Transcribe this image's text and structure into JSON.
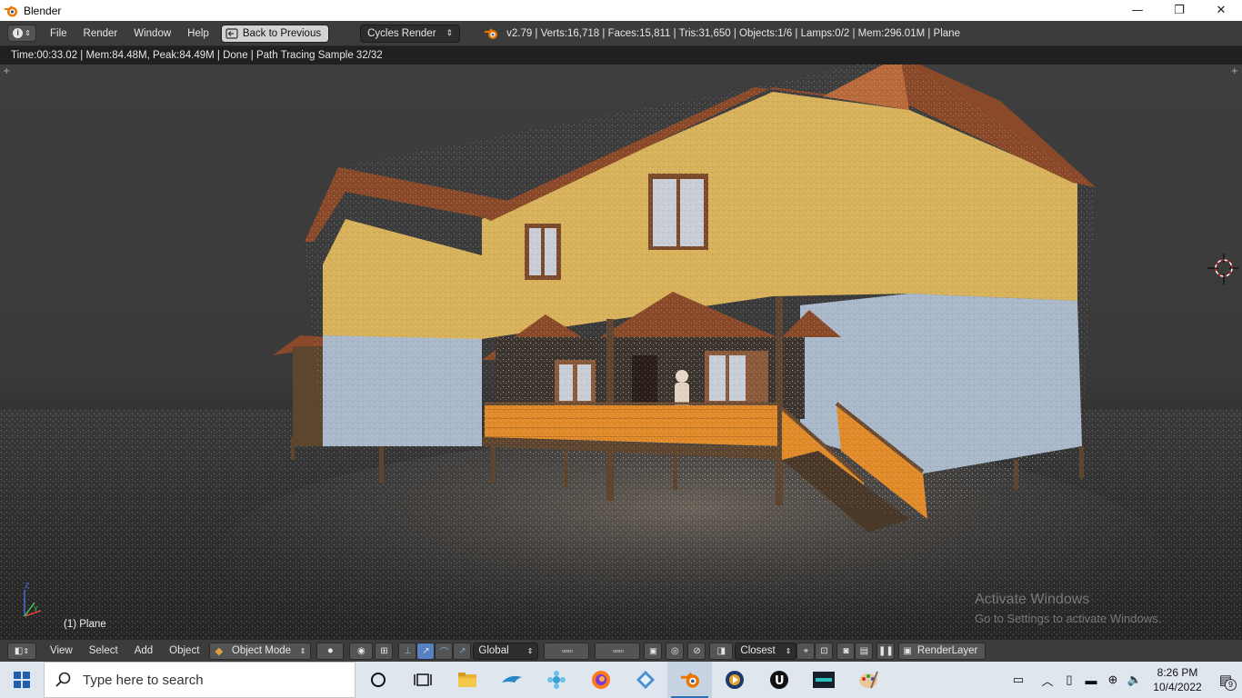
{
  "window": {
    "title": "Blender",
    "min": "—",
    "max": "❐",
    "close": "✕"
  },
  "info_header": {
    "menus": [
      "File",
      "Render",
      "Window",
      "Help"
    ],
    "back_button": "Back to Previous",
    "render_engine": "Cycles Render",
    "stats": "v2.79 | Verts:16,718 | Faces:15,811 | Tris:31,650 | Objects:1/6 | Lamps:0/2 | Mem:296.01M | Plane"
  },
  "viewport": {
    "render_status": "Time:00:33.02 | Mem:84.48M, Peak:84.49M | Done | Path Tracing Sample 32/32",
    "object_label": "(1) Plane",
    "watermark_line1": "Activate Windows",
    "watermark_line2": "Go to Settings to activate Windows.",
    "axis_z": "Z",
    "axis_y": "Y"
  },
  "view3d_header": {
    "menus": [
      "View",
      "Select",
      "Add",
      "Object"
    ],
    "mode": "Object Mode",
    "orientation": "Global",
    "snap_target": "Closest",
    "render_layer": "RenderLayer"
  },
  "taskbar": {
    "search_placeholder": "Type here to search",
    "time": "8:26 PM",
    "date": "10/4/2022",
    "notification_count": "9",
    "apps": [
      "cortana",
      "task-view",
      "file-explorer",
      "dolphin",
      "puzzle",
      "firefox",
      "app-diamond",
      "blender",
      "media-app",
      "unreal-engine",
      "dark-app",
      "paint-app"
    ]
  },
  "colors": {
    "header_bg": "#3c3c3c",
    "render_status_bg": "#202020",
    "taskbar_bg": "#dfe6ee",
    "wall_upper": "#d8b25a",
    "wall_lower": "#a9b9c9",
    "roof": "#8a4a2a",
    "railing": "#e08a2a"
  }
}
